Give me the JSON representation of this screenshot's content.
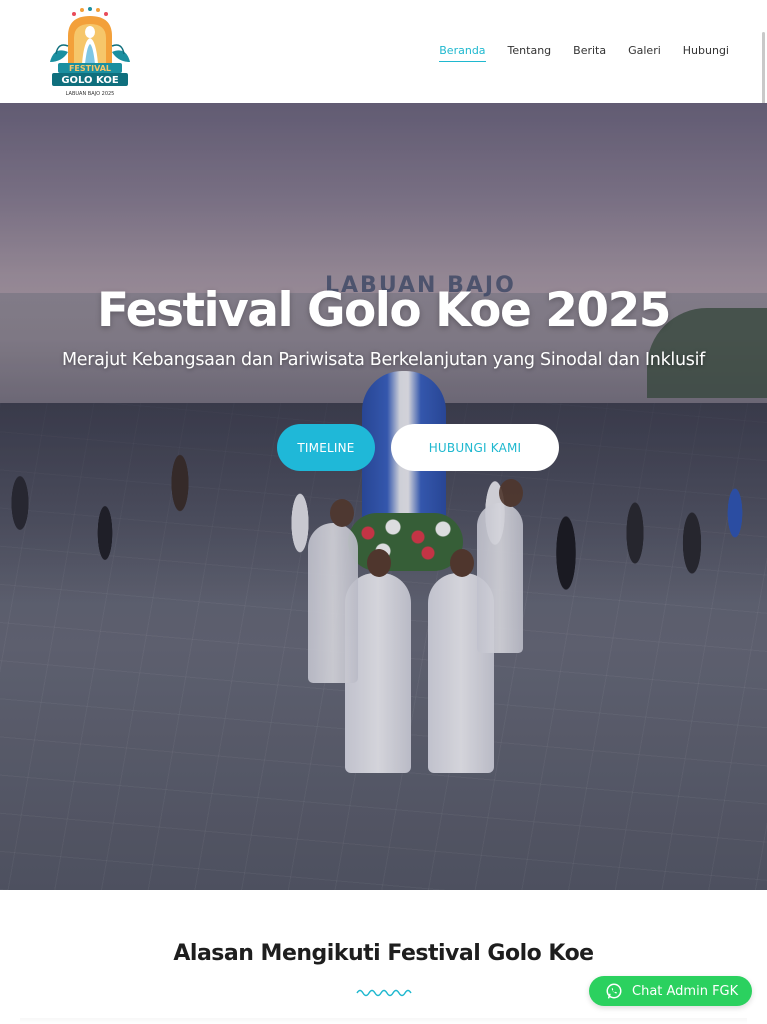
{
  "logo": {
    "line1": "FESTIVAL",
    "line2": "GOLO KOE",
    "line3": "LABUAN BAJO 2025"
  },
  "nav": {
    "items": [
      {
        "label": "Beranda",
        "active": true
      },
      {
        "label": "Tentang",
        "active": false
      },
      {
        "label": "Berita",
        "active": false
      },
      {
        "label": "Galeri",
        "active": false
      },
      {
        "label": "Hubungi",
        "active": false
      }
    ]
  },
  "hero": {
    "background_sign": "LABUAN BAJO",
    "title": "Festival Golo Koe 2025",
    "subtitle": "Merajut Kebangsaan dan Pariwisata Berkelanjutan yang Sinodal dan Inklusif",
    "primary_button": "TIMELINE",
    "secondary_button": "HUBUNGI KAMI"
  },
  "section": {
    "title": "Alasan Mengikuti Festival Golo Koe"
  },
  "chat": {
    "label": "Chat Admin FGK",
    "icon": "whatsapp-icon"
  },
  "colors": {
    "accent": "#1fb8d8",
    "chat_green": "#2bd15f",
    "logo_orange": "#f08a24",
    "logo_teal": "#1a8fa0"
  }
}
